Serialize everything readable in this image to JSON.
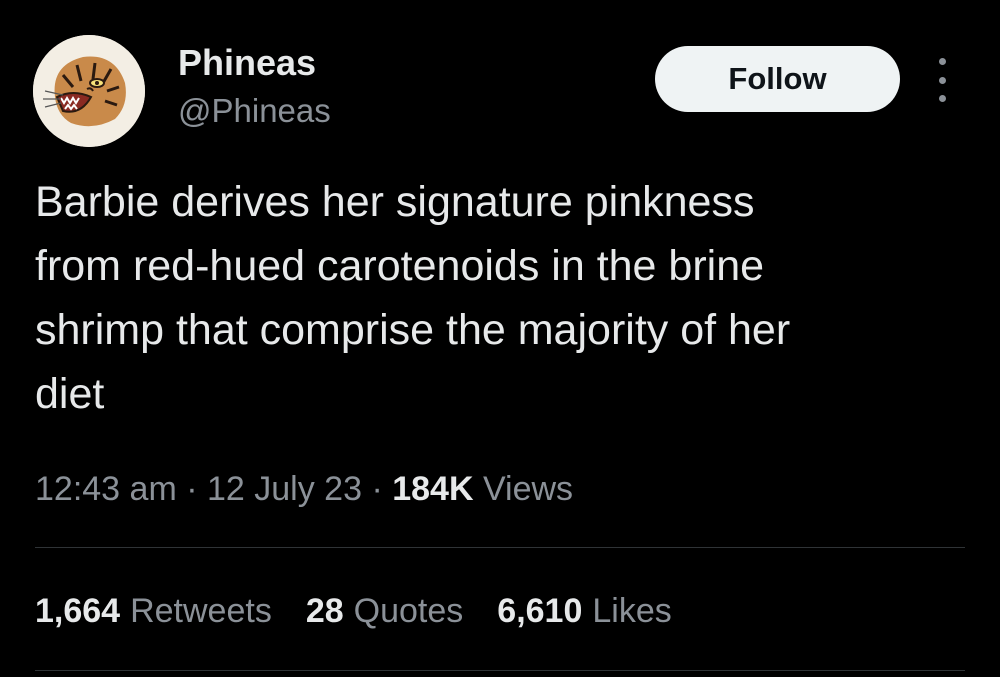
{
  "theme": {
    "background": "#000000",
    "primary_text": "#e7e9ea",
    "secondary_text": "#8b9198",
    "follow_button_bg": "#eff3f4",
    "divider": "#2f3336"
  },
  "author": {
    "avatar_icon": "tiger-avatar-icon",
    "display_name": "Phineas",
    "handle": "@Phineas"
  },
  "actions": {
    "follow_label": "Follow",
    "more_icon": "more-options-icon"
  },
  "tweet": {
    "text": "Barbie derives her signature pinkness\nfrom red-hued carotenoids in the brine\nshrimp that comprise the majority of her\ndiet"
  },
  "meta": {
    "time": "12:43 am",
    "separator": "·",
    "date": "12 July 23",
    "views_count": "184K",
    "views_label": "Views"
  },
  "stats": [
    {
      "count": "1,664",
      "label": "Retweets"
    },
    {
      "count": "28",
      "label": "Quotes"
    },
    {
      "count": "6,610",
      "label": "Likes"
    }
  ]
}
